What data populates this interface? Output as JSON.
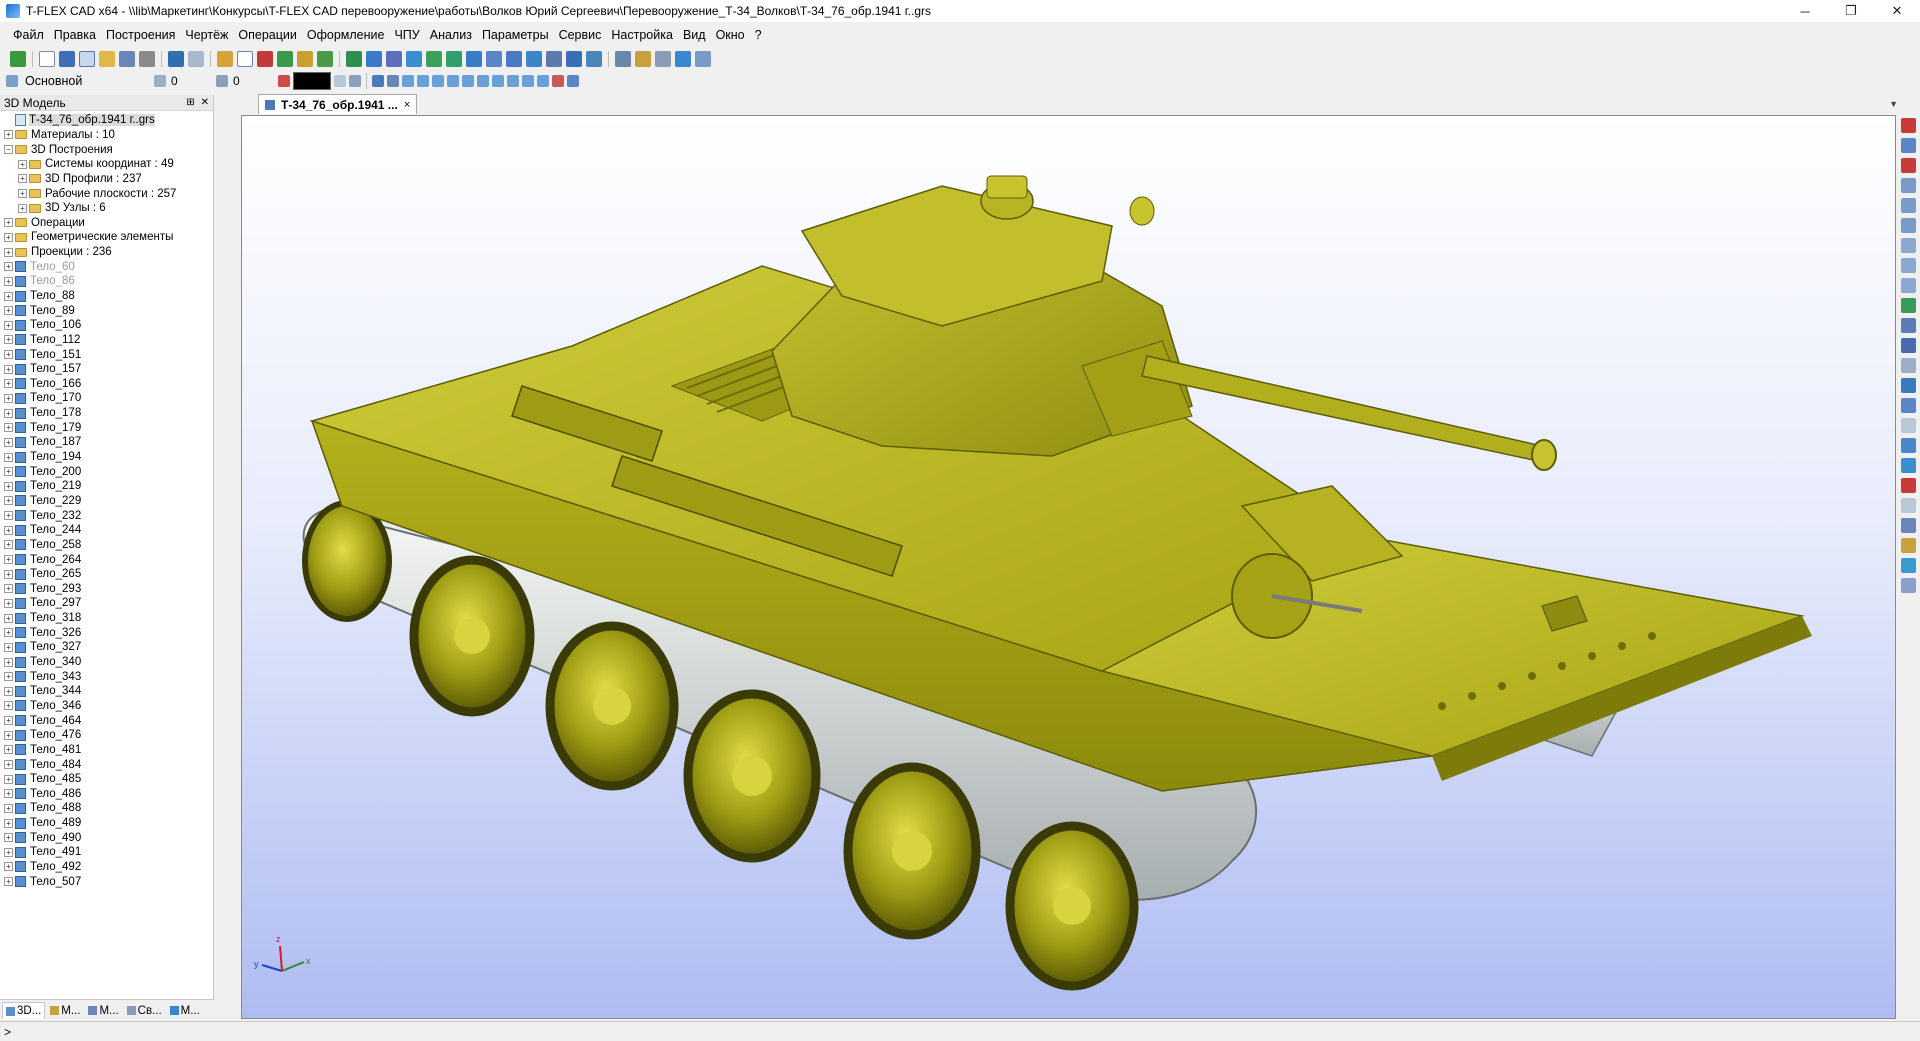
{
  "window": {
    "title": "T-FLEX CAD x64 - \\\\lib\\Маркетинг\\Конкурсы\\T-FLEX CAD перевооружение\\работы\\Волков Юрий Сергеевич\\Перевооружение_Т-34_Волков\\Т-34_76_обр.1941 г..grs",
    "minimize": "─",
    "restore": "❐",
    "close": "✕"
  },
  "menu": [
    "Файл",
    "Правка",
    "Построения",
    "Чертёж",
    "Операции",
    "Оформление",
    "ЧПУ",
    "Анализ",
    "Параметры",
    "Сервис",
    "Настройка",
    "Вид",
    "Окно",
    "?"
  ],
  "toolbar2": {
    "layer": "Основной",
    "level_value": "0",
    "priority_value": "0",
    "color": "#000000"
  },
  "panel": {
    "title": "3D Модель",
    "pin": "⊞",
    "close": "✕",
    "tree": [
      {
        "label": "Т-34_76_обр.1941 г..grs",
        "icon": "document-icon",
        "indent": 0,
        "expander": "",
        "style": "selected"
      },
      {
        "label": "Материалы : 10",
        "icon": "folder-icon",
        "indent": 0,
        "expander": "+",
        "style": ""
      },
      {
        "label": "3D Построения",
        "icon": "folder-icon",
        "indent": 0,
        "expander": "−",
        "style": ""
      },
      {
        "label": "Системы координат : 49",
        "icon": "folder-icon",
        "indent": 1,
        "expander": "+",
        "style": ""
      },
      {
        "label": "3D Профили : 237",
        "icon": "folder-icon",
        "indent": 1,
        "expander": "+",
        "style": ""
      },
      {
        "label": "Рабочие плоскости : 257",
        "icon": "folder-icon",
        "indent": 1,
        "expander": "+",
        "style": ""
      },
      {
        "label": "3D Узлы : 6",
        "icon": "folder-icon",
        "indent": 1,
        "expander": "+",
        "style": ""
      },
      {
        "label": "Операции",
        "icon": "folder-icon",
        "indent": 0,
        "expander": "+",
        "style": ""
      },
      {
        "label": "Геометрические элементы",
        "icon": "folder-icon",
        "indent": 0,
        "expander": "+",
        "style": ""
      },
      {
        "label": "Проекции : 236",
        "icon": "folder-icon",
        "indent": 0,
        "expander": "+",
        "style": ""
      },
      {
        "label": "Тело_60",
        "icon": "body-icon",
        "indent": 0,
        "expander": "+",
        "style": "dim"
      },
      {
        "label": "Тело_86",
        "icon": "body-icon",
        "indent": 0,
        "expander": "+",
        "style": "dim"
      },
      {
        "label": "Тело_88",
        "icon": "body-icon",
        "indent": 0,
        "expander": "+",
        "style": ""
      },
      {
        "label": "Тело_89",
        "icon": "body-icon",
        "indent": 0,
        "expander": "+",
        "style": ""
      },
      {
        "label": "Тело_106",
        "icon": "body-icon",
        "indent": 0,
        "expander": "+",
        "style": ""
      },
      {
        "label": "Тело_112",
        "icon": "body-icon",
        "indent": 0,
        "expander": "+",
        "style": ""
      },
      {
        "label": "Тело_151",
        "icon": "body-icon",
        "indent": 0,
        "expander": "+",
        "style": ""
      },
      {
        "label": "Тело_157",
        "icon": "body-icon",
        "indent": 0,
        "expander": "+",
        "style": ""
      },
      {
        "label": "Тело_166",
        "icon": "body-icon",
        "indent": 0,
        "expander": "+",
        "style": ""
      },
      {
        "label": "Тело_170",
        "icon": "body-icon",
        "indent": 0,
        "expander": "+",
        "style": ""
      },
      {
        "label": "Тело_178",
        "icon": "body-icon",
        "indent": 0,
        "expander": "+",
        "style": ""
      },
      {
        "label": "Тело_179",
        "icon": "body-icon",
        "indent": 0,
        "expander": "+",
        "style": ""
      },
      {
        "label": "Тело_187",
        "icon": "body-icon",
        "indent": 0,
        "expander": "+",
        "style": ""
      },
      {
        "label": "Тело_194",
        "icon": "body-icon",
        "indent": 0,
        "expander": "+",
        "style": ""
      },
      {
        "label": "Тело_200",
        "icon": "body-icon",
        "indent": 0,
        "expander": "+",
        "style": ""
      },
      {
        "label": "Тело_219",
        "icon": "body-icon",
        "indent": 0,
        "expander": "+",
        "style": ""
      },
      {
        "label": "Тело_229",
        "icon": "body-icon",
        "indent": 0,
        "expander": "+",
        "style": ""
      },
      {
        "label": "Тело_232",
        "icon": "body-icon",
        "indent": 0,
        "expander": "+",
        "style": ""
      },
      {
        "label": "Тело_244",
        "icon": "body-icon",
        "indent": 0,
        "expander": "+",
        "style": ""
      },
      {
        "label": "Тело_258",
        "icon": "body-icon",
        "indent": 0,
        "expander": "+",
        "style": ""
      },
      {
        "label": "Тело_264",
        "icon": "body-icon",
        "indent": 0,
        "expander": "+",
        "style": ""
      },
      {
        "label": "Тело_265",
        "icon": "body-icon",
        "indent": 0,
        "expander": "+",
        "style": ""
      },
      {
        "label": "Тело_293",
        "icon": "body-icon",
        "indent": 0,
        "expander": "+",
        "style": ""
      },
      {
        "label": "Тело_297",
        "icon": "body-icon",
        "indent": 0,
        "expander": "+",
        "style": ""
      },
      {
        "label": "Тело_318",
        "icon": "body-icon",
        "indent": 0,
        "expander": "+",
        "style": ""
      },
      {
        "label": "Тело_326",
        "icon": "body-icon",
        "indent": 0,
        "expander": "+",
        "style": ""
      },
      {
        "label": "Тело_327",
        "icon": "body-icon",
        "indent": 0,
        "expander": "+",
        "style": ""
      },
      {
        "label": "Тело_340",
        "icon": "body-icon",
        "indent": 0,
        "expander": "+",
        "style": ""
      },
      {
        "label": "Тело_343",
        "icon": "body-icon",
        "indent": 0,
        "expander": "+",
        "style": ""
      },
      {
        "label": "Тело_344",
        "icon": "body-icon",
        "indent": 0,
        "expander": "+",
        "style": ""
      },
      {
        "label": "Тело_346",
        "icon": "body-icon",
        "indent": 0,
        "expander": "+",
        "style": ""
      },
      {
        "label": "Тело_464",
        "icon": "body-icon",
        "indent": 0,
        "expander": "+",
        "style": ""
      },
      {
        "label": "Тело_476",
        "icon": "body-icon",
        "indent": 0,
        "expander": "+",
        "style": ""
      },
      {
        "label": "Тело_481",
        "icon": "body-icon",
        "indent": 0,
        "expander": "+",
        "style": ""
      },
      {
        "label": "Тело_484",
        "icon": "body-icon",
        "indent": 0,
        "expander": "+",
        "style": ""
      },
      {
        "label": "Тело_485",
        "icon": "body-icon",
        "indent": 0,
        "expander": "+",
        "style": ""
      },
      {
        "label": "Тело_486",
        "icon": "body-icon",
        "indent": 0,
        "expander": "+",
        "style": ""
      },
      {
        "label": "Тело_488",
        "icon": "body-icon",
        "indent": 0,
        "expander": "+",
        "style": ""
      },
      {
        "label": "Тело_489",
        "icon": "body-icon",
        "indent": 0,
        "expander": "+",
        "style": ""
      },
      {
        "label": "Тело_490",
        "icon": "body-icon",
        "indent": 0,
        "expander": "+",
        "style": ""
      },
      {
        "label": "Тело_491",
        "icon": "body-icon",
        "indent": 0,
        "expander": "+",
        "style": ""
      },
      {
        "label": "Тело_492",
        "icon": "body-icon",
        "indent": 0,
        "expander": "+",
        "style": ""
      },
      {
        "label": "Тело_507",
        "icon": "body-icon",
        "indent": 0,
        "expander": "+",
        "style": ""
      }
    ],
    "bottom_tabs": [
      "3D...",
      "М...",
      "М...",
      "Св...",
      "М..."
    ]
  },
  "document_tab": {
    "label": "Т-34_76_обр.1941 ...",
    "close": "×"
  },
  "viewport": {
    "axis_labels": {
      "x": "x",
      "y": "y",
      "z": "z"
    },
    "model_color": "#b7b61e"
  },
  "statusbar": {
    "text": ">"
  }
}
